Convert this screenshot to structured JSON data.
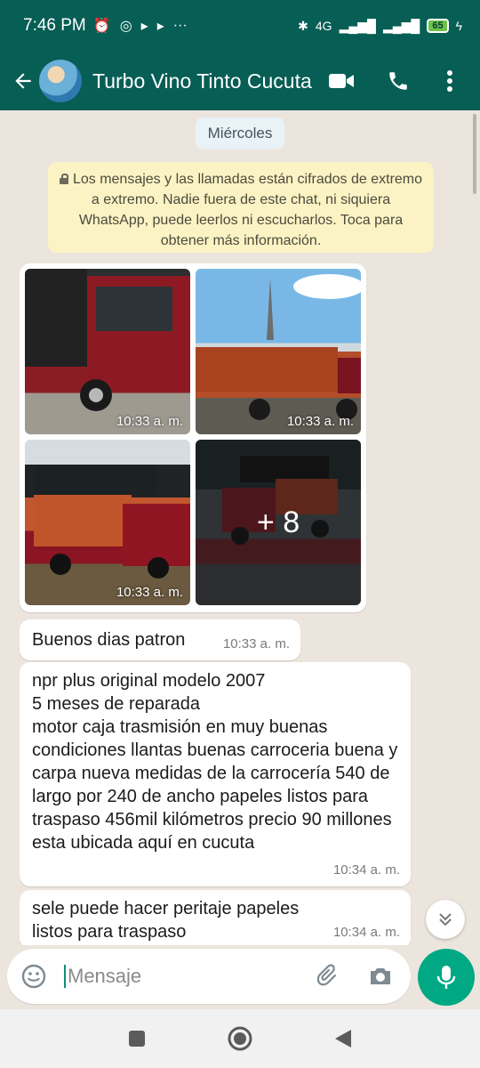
{
  "status_bar": {
    "time": "7:46 PM",
    "network_label": "4G",
    "battery": "65"
  },
  "header": {
    "contact_name": "Turbo Vino Tinto Cucuta"
  },
  "chat": {
    "date_chip": "Miércoles",
    "encryption_notice": "Los mensajes y las llamadas están cifrados de extremo a extremo. Nadie fuera de este chat, ni siquiera WhatsApp, puede leerlos ni escucharlos. Toca para obtener más información.",
    "photos": [
      {
        "time": "10:33 a. m."
      },
      {
        "time": "10:33 a. m."
      },
      {
        "time": "10:33 a. m."
      },
      {
        "more_count": "+ 8"
      }
    ],
    "messages": [
      {
        "text": "Buenos dias patron",
        "time": "10:33 a. m."
      },
      {
        "text": "npr plus original modelo 2007\n 5 meses de reparada\nmotor caja trasmisión en muy buenas condiciones llantas buenas carroceria buena y carpa nueva medidas de la carrocería 540 de largo por 240 de ancho papeles listos para traspaso 456mil kilómetros precio 90 millones esta ubicada aquí en cucuta",
        "time": "10:34 a. m."
      },
      {
        "text": "sele puede hacer peritaje papeles listos para traspaso",
        "time": "10:34 a. m."
      }
    ]
  },
  "input": {
    "placeholder": "Mensaje"
  },
  "colors": {
    "header": "#075e54",
    "accent": "#00a884",
    "chat_bg": "#ece5dd",
    "notice_bg": "#fcf3c4"
  },
  "icons": {
    "header": [
      "back-arrow-icon",
      "video-call-icon",
      "phone-icon",
      "more-vert-icon"
    ],
    "input": [
      "emoji-icon",
      "attach-icon",
      "camera-icon",
      "mic-icon"
    ],
    "nav": [
      "recents-icon",
      "home-icon",
      "back-icon"
    ]
  }
}
